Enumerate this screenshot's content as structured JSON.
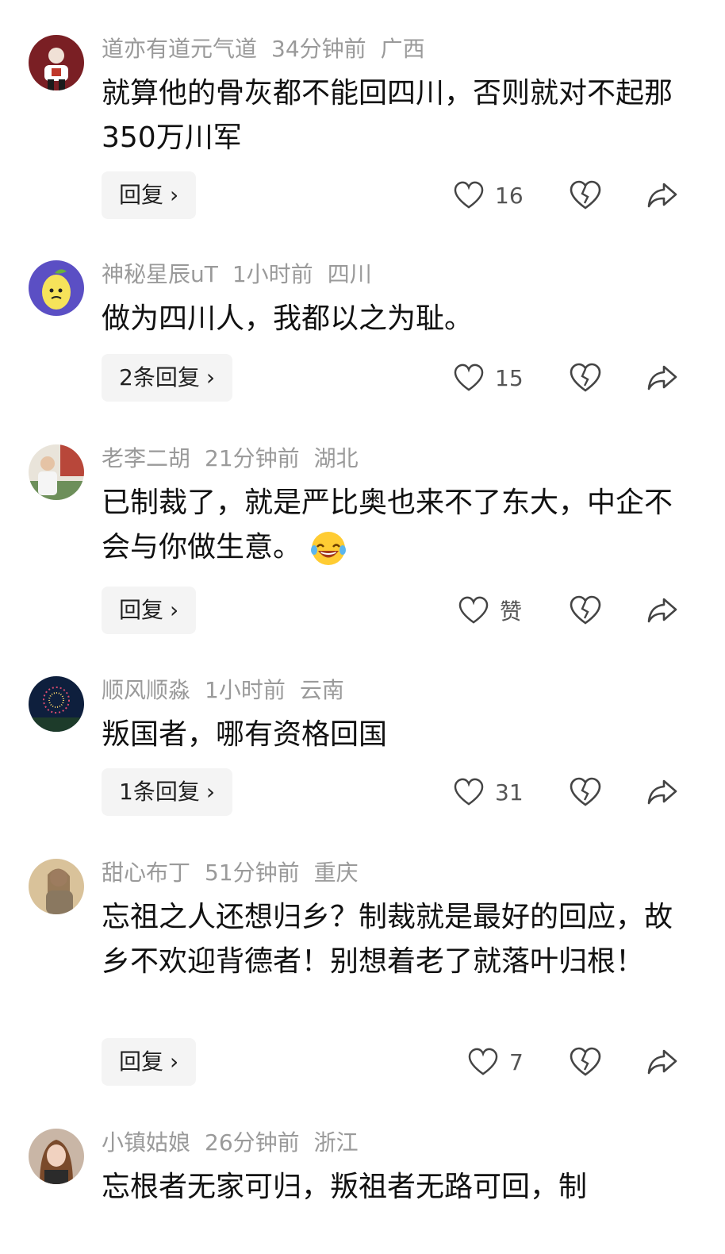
{
  "comments": [
    {
      "username": "道亦有道元气道",
      "time": "34分钟前",
      "location": "广西",
      "text": "就算他的骨灰都不能回四川，否则就对不起那350万川军",
      "reply_label": "回复",
      "likes": "16",
      "avatar_icon": "user-avatar-red-figure"
    },
    {
      "username": "神秘星辰uT",
      "time": "1小时前",
      "location": "四川",
      "text": "做为四川人，我都以之为耻。",
      "reply_label": "2条回复",
      "likes": "15",
      "avatar_icon": "user-avatar-lemon"
    },
    {
      "username": "老李二胡",
      "time": "21分钟前",
      "location": "湖北",
      "text": "已制裁了，就是严比奥也来不了东大，中企不会与你做生意。",
      "emoji": "laughing-tears-emoji",
      "reply_label": "回复",
      "likes": "赞",
      "avatar_icon": "user-avatar-man-outdoors"
    },
    {
      "username": "顺风顺淼",
      "time": "1小时前",
      "location": "云南",
      "text": "叛国者，哪有资格回国",
      "reply_label": "1条回复",
      "likes": "31",
      "avatar_icon": "user-avatar-fireworks"
    },
    {
      "username": "甜心布丁",
      "time": "51分钟前",
      "location": "重庆",
      "text": "忘祖之人还想归乡？制裁就是最好的回应，故乡不欢迎背德者！别想着老了就落叶归根！",
      "reply_label": "回复",
      "likes": "7",
      "avatar_icon": "user-avatar-woman-photo"
    },
    {
      "username": "小镇姑娘",
      "time": "26分钟前",
      "location": "浙江",
      "text": "忘根者无家可归，叛祖者无路可回，制",
      "reply_label": "",
      "likes": "",
      "avatar_icon": "user-avatar-woman-portrait"
    }
  ],
  "icons": {
    "like": "heart-outline-icon",
    "dislike": "broken-heart-icon",
    "share": "share-arrow-icon",
    "chevron": "chevron-right-icon"
  },
  "colors": {
    "meta": "#9a9a9a",
    "button_bg": "#f4f4f4",
    "text": "#111111"
  }
}
